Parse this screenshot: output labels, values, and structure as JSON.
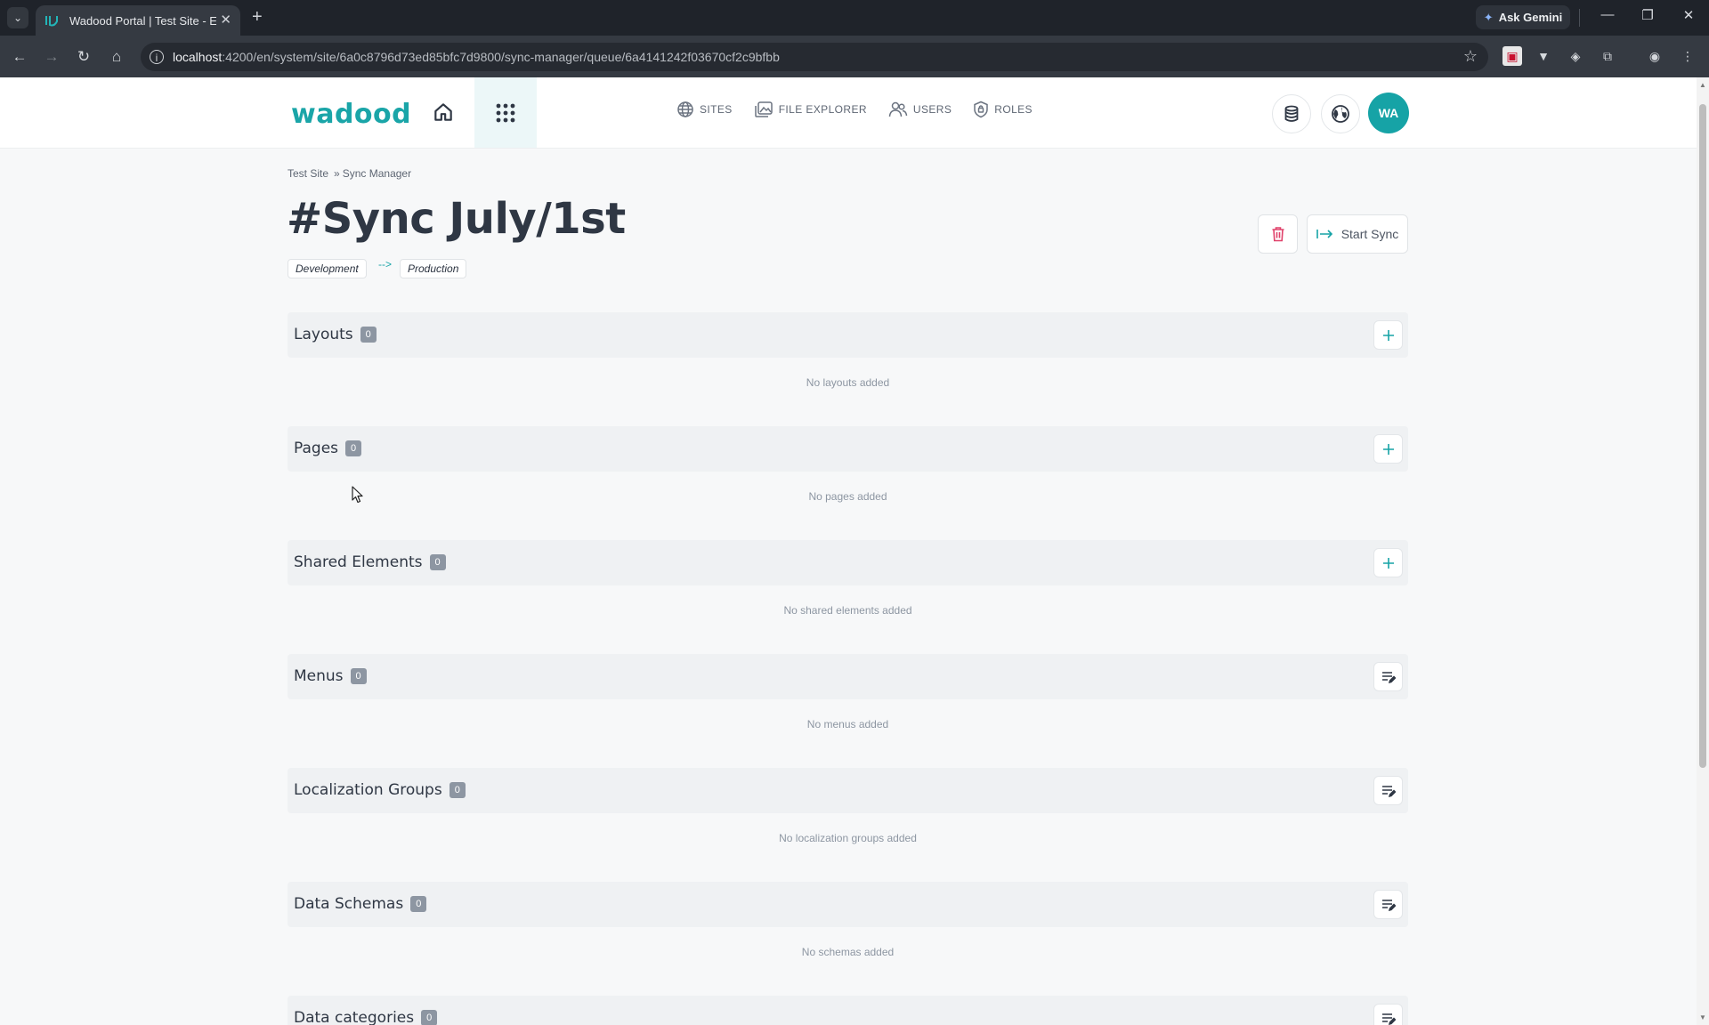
{
  "browser": {
    "tab_title": "Wadood Portal | Test Site - Edit",
    "url_host": "localhost",
    "url_rest": ":4200/en/system/site/6a0c8796d73ed85bfc7d9800/sync-manager/queue/6a4141242f03670cf2c9bfbb",
    "gemini_label": "Ask Gemini"
  },
  "app": {
    "logo_text": "wadood",
    "nav": [
      {
        "label": "SITES",
        "icon": "globe-icon"
      },
      {
        "label": "FILE EXPLORER",
        "icon": "images-icon"
      },
      {
        "label": "USERS",
        "icon": "users-icon"
      },
      {
        "label": "ROLES",
        "icon": "shield-icon"
      }
    ],
    "avatar_initials": "WA",
    "accent_color": "#16a3a6",
    "danger_color": "#e0416a"
  },
  "breadcrumb": {
    "site": "Test Site",
    "separator": "»",
    "current": "Sync Manager"
  },
  "page": {
    "title": "#Sync July/1st",
    "source_env": "Development",
    "arrow": "-->",
    "target_env": "Production",
    "start_sync_label": "Start Sync"
  },
  "sections": [
    {
      "title": "Layouts",
      "count": "0",
      "empty": "No layouts added",
      "action": "add"
    },
    {
      "title": "Pages",
      "count": "0",
      "empty": "No pages added",
      "action": "add"
    },
    {
      "title": "Shared Elements",
      "count": "0",
      "empty": "No shared elements added",
      "action": "add"
    },
    {
      "title": "Menus",
      "count": "0",
      "empty": "No menus added",
      "action": "edit-list"
    },
    {
      "title": "Localization Groups",
      "count": "0",
      "empty": "No localization groups added",
      "action": "edit-list"
    },
    {
      "title": "Data Schemas",
      "count": "0",
      "empty": "No schemas added",
      "action": "edit-list"
    },
    {
      "title": "Data categories",
      "count": "0",
      "empty": "",
      "action": "edit-list"
    }
  ]
}
